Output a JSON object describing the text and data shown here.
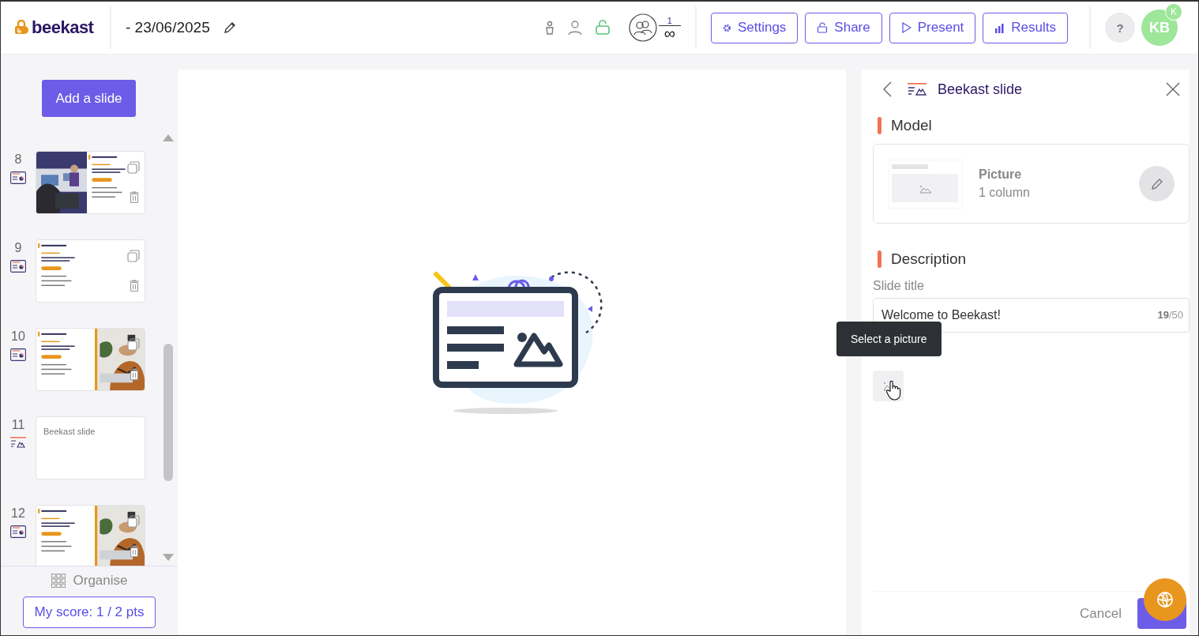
{
  "header": {
    "logo": "beekast",
    "date": "- 23/06/2025",
    "participants": {
      "count": "1",
      "limit": "∞"
    },
    "buttons": [
      {
        "label": "Settings"
      },
      {
        "label": "Share"
      },
      {
        "label": "Present"
      },
      {
        "label": "Results"
      }
    ],
    "help": "?",
    "avatar": {
      "initials": "KB",
      "badge": "K"
    }
  },
  "sidebar": {
    "add_button": "Add a slide",
    "slides": [
      {
        "number": "8",
        "kind": "photo_left"
      },
      {
        "number": "9",
        "kind": "text"
      },
      {
        "number": "10",
        "kind": "photo_right"
      },
      {
        "number": "11",
        "kind": "picture",
        "title": "Beekast slide"
      },
      {
        "number": "12",
        "kind": "photo_right"
      }
    ],
    "organise": "Organise",
    "score": "My score: 1 / 2 pts"
  },
  "panel": {
    "title": "Beekast slide",
    "model": {
      "heading": "Model",
      "name": "Picture",
      "detail": "1 column"
    },
    "description": {
      "heading": "Description",
      "field_label": "Slide title",
      "value": "Welcome to Beekast!",
      "counter": "**19**/50"
    },
    "tooltip": "Select a picture",
    "cancel": "Cancel"
  }
}
